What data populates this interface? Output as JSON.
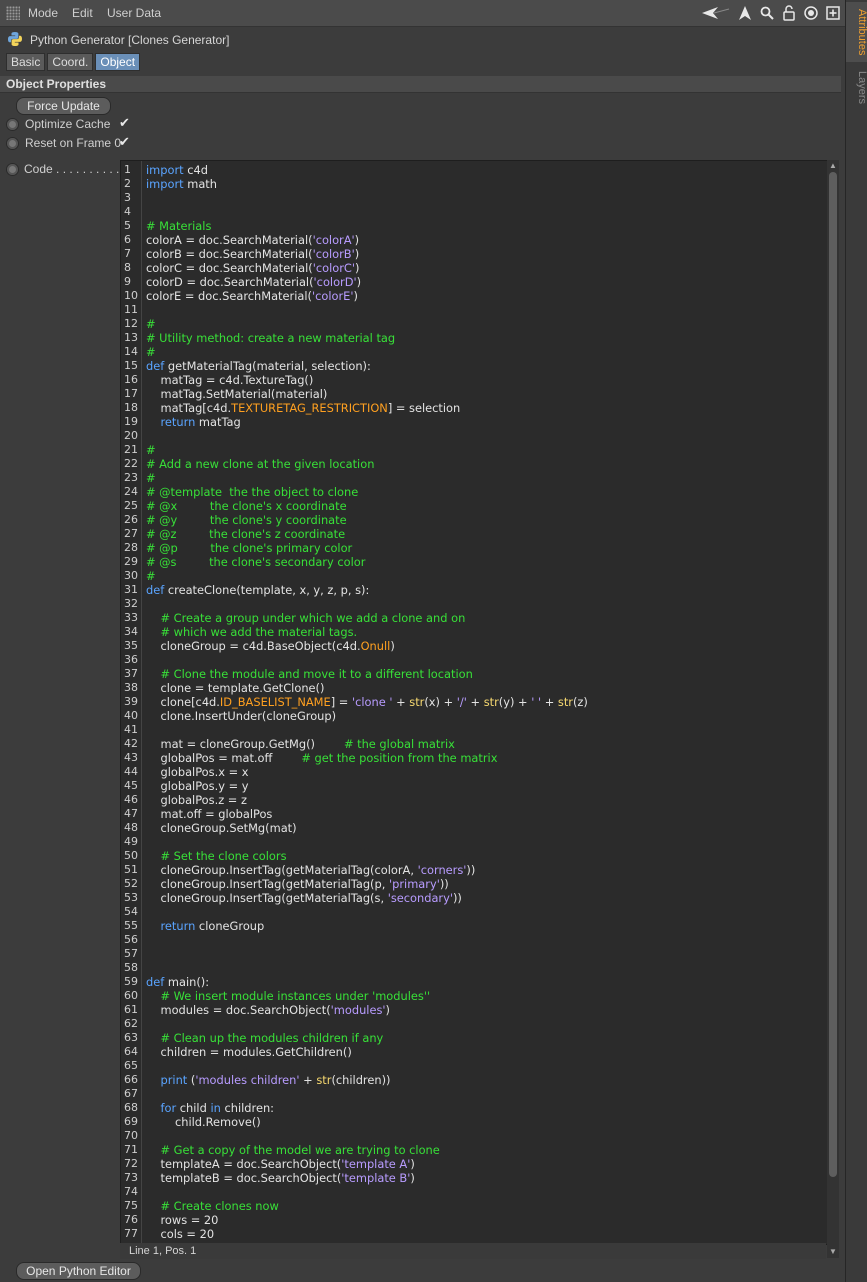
{
  "menubar": {
    "items": [
      "Mode",
      "Edit",
      "User Data"
    ],
    "icons": [
      "back-arrow-icon",
      "cursor-icon",
      "search-icon",
      "lock-icon",
      "target-icon",
      "new-window-icon"
    ]
  },
  "header": {
    "title": "Python Generator [Clones Generator]",
    "tabs": [
      {
        "label": "Basic",
        "active": false
      },
      {
        "label": "Coord.",
        "active": false
      },
      {
        "label": "Object",
        "active": true
      }
    ]
  },
  "section": {
    "title": "Object Properties"
  },
  "properties": {
    "force_update_label": "Force Update",
    "optimize_cache_label": "Optimize Cache",
    "optimize_cache_checked": true,
    "reset_on_frame_label": "Reset on Frame 0",
    "reset_on_frame_checked": true,
    "code_label": "Code . . . . . . . . . ."
  },
  "editor": {
    "language": "python",
    "lines": [
      [
        [
          "kw",
          "import"
        ],
        [
          "tx",
          " c4d"
        ]
      ],
      [
        [
          "kw",
          "import"
        ],
        [
          "tx",
          " math"
        ]
      ],
      [],
      [],
      [
        [
          "cm",
          "# Materials"
        ]
      ],
      [
        [
          "tx",
          "colorA = doc.SearchMaterial("
        ],
        [
          "st",
          "'colorA'"
        ],
        [
          "tx",
          ")"
        ]
      ],
      [
        [
          "tx",
          "colorB = doc.SearchMaterial("
        ],
        [
          "st",
          "'colorB'"
        ],
        [
          "tx",
          ")"
        ]
      ],
      [
        [
          "tx",
          "colorC = doc.SearchMaterial("
        ],
        [
          "st",
          "'colorC'"
        ],
        [
          "tx",
          ")"
        ]
      ],
      [
        [
          "tx",
          "colorD = doc.SearchMaterial("
        ],
        [
          "st",
          "'colorD'"
        ],
        [
          "tx",
          ")"
        ]
      ],
      [
        [
          "tx",
          "colorE = doc.SearchMaterial("
        ],
        [
          "st",
          "'colorE'"
        ],
        [
          "tx",
          ")"
        ]
      ],
      [],
      [
        [
          "cm",
          "#"
        ]
      ],
      [
        [
          "cm",
          "# Utility method: create a new material tag"
        ]
      ],
      [
        [
          "cm",
          "#"
        ]
      ],
      [
        [
          "kw",
          "def"
        ],
        [
          "tx",
          " getMaterialTag(material, selection):"
        ]
      ],
      [
        [
          "tx",
          "    matTag = c4d.TextureTag()"
        ]
      ],
      [
        [
          "tx",
          "    matTag.SetMaterial(material)"
        ]
      ],
      [
        [
          "tx",
          "    matTag[c4d."
        ],
        [
          "or",
          "TEXTURETAG_RESTRICTION"
        ],
        [
          "tx",
          "] = selection"
        ]
      ],
      [
        [
          "tx",
          "    "
        ],
        [
          "kw",
          "return"
        ],
        [
          "tx",
          " matTag"
        ]
      ],
      [],
      [
        [
          "cm",
          "#"
        ]
      ],
      [
        [
          "cm",
          "# Add a new clone at the given location"
        ]
      ],
      [
        [
          "cm",
          "#"
        ]
      ],
      [
        [
          "cm",
          "# @template  the the object to clone"
        ]
      ],
      [
        [
          "cm",
          "# @x         the clone's x coordinate"
        ]
      ],
      [
        [
          "cm",
          "# @y         the clone's y coordinate"
        ]
      ],
      [
        [
          "cm",
          "# @z         the clone's z coordinate"
        ]
      ],
      [
        [
          "cm",
          "# @p         the clone's primary color"
        ]
      ],
      [
        [
          "cm",
          "# @s         the clone's secondary color"
        ]
      ],
      [
        [
          "cm",
          "#"
        ]
      ],
      [
        [
          "kw",
          "def"
        ],
        [
          "tx",
          " createClone(template, x, y, z, p, s):"
        ]
      ],
      [],
      [
        [
          "tx",
          "    "
        ],
        [
          "cm",
          "# Create a group under which we add a clone and on"
        ]
      ],
      [
        [
          "tx",
          "    "
        ],
        [
          "cm",
          "# which we add the material tags."
        ]
      ],
      [
        [
          "tx",
          "    cloneGroup = c4d.BaseObject(c4d."
        ],
        [
          "or",
          "Onull"
        ],
        [
          "tx",
          ")"
        ]
      ],
      [],
      [
        [
          "tx",
          "    "
        ],
        [
          "cm",
          "# Clone the module and move it to a different location"
        ]
      ],
      [
        [
          "tx",
          "    clone = template.GetClone()"
        ]
      ],
      [
        [
          "tx",
          "    clone[c4d."
        ],
        [
          "or",
          "ID_BASELIST_NAME"
        ],
        [
          "tx",
          "] = "
        ],
        [
          "st",
          "'clone '"
        ],
        [
          "tx",
          " + "
        ],
        [
          "bi",
          "str"
        ],
        [
          "tx",
          "(x) + "
        ],
        [
          "st",
          "'/'"
        ],
        [
          "tx",
          " + "
        ],
        [
          "bi",
          "str"
        ],
        [
          "tx",
          "(y) + "
        ],
        [
          "st",
          "' '"
        ],
        [
          "tx",
          " + "
        ],
        [
          "bi",
          "str"
        ],
        [
          "tx",
          "(z)"
        ]
      ],
      [
        [
          "tx",
          "    clone.InsertUnder(cloneGroup)"
        ]
      ],
      [],
      [
        [
          "tx",
          "    mat = cloneGroup.GetMg()        "
        ],
        [
          "cm",
          "# the global matrix"
        ]
      ],
      [
        [
          "tx",
          "    globalPos = mat.off        "
        ],
        [
          "cm",
          "# get the position from the matrix"
        ]
      ],
      [
        [
          "tx",
          "    globalPos.x = x"
        ]
      ],
      [
        [
          "tx",
          "    globalPos.y = y"
        ]
      ],
      [
        [
          "tx",
          "    globalPos.z = z"
        ]
      ],
      [
        [
          "tx",
          "    mat.off = globalPos"
        ]
      ],
      [
        [
          "tx",
          "    cloneGroup.SetMg(mat)"
        ]
      ],
      [],
      [
        [
          "tx",
          "    "
        ],
        [
          "cm",
          "# Set the clone colors"
        ]
      ],
      [
        [
          "tx",
          "    cloneGroup.InsertTag(getMaterialTag(colorA, "
        ],
        [
          "st",
          "'corners'"
        ],
        [
          "tx",
          "))"
        ]
      ],
      [
        [
          "tx",
          "    cloneGroup.InsertTag(getMaterialTag(p, "
        ],
        [
          "st",
          "'primary'"
        ],
        [
          "tx",
          "))"
        ]
      ],
      [
        [
          "tx",
          "    cloneGroup.InsertTag(getMaterialTag(s, "
        ],
        [
          "st",
          "'secondary'"
        ],
        [
          "tx",
          "))"
        ]
      ],
      [],
      [
        [
          "tx",
          "    "
        ],
        [
          "kw",
          "return"
        ],
        [
          "tx",
          " cloneGroup"
        ]
      ],
      [],
      [],
      [],
      [
        [
          "kw",
          "def"
        ],
        [
          "tx",
          " main():"
        ]
      ],
      [
        [
          "tx",
          "    "
        ],
        [
          "cm",
          "# We insert module instances under 'modules''"
        ]
      ],
      [
        [
          "tx",
          "    modules = doc.SearchObject("
        ],
        [
          "st",
          "'modules'"
        ],
        [
          "tx",
          ")"
        ]
      ],
      [],
      [
        [
          "tx",
          "    "
        ],
        [
          "cm",
          "# Clean up the modules children if any"
        ]
      ],
      [
        [
          "tx",
          "    children = modules.GetChildren()"
        ]
      ],
      [],
      [
        [
          "tx",
          "    "
        ],
        [
          "kw",
          "print"
        ],
        [
          "tx",
          " ("
        ],
        [
          "st",
          "'modules children'"
        ],
        [
          "tx",
          " + "
        ],
        [
          "bi",
          "str"
        ],
        [
          "tx",
          "(children))"
        ]
      ],
      [],
      [
        [
          "tx",
          "    "
        ],
        [
          "kw",
          "for"
        ],
        [
          "tx",
          " child "
        ],
        [
          "kw",
          "in"
        ],
        [
          "tx",
          " children:"
        ]
      ],
      [
        [
          "tx",
          "        child.Remove()"
        ]
      ],
      [],
      [
        [
          "tx",
          "    "
        ],
        [
          "cm",
          "# Get a copy of the model we are trying to clone"
        ]
      ],
      [
        [
          "tx",
          "    templateA = doc.SearchObject("
        ],
        [
          "st",
          "'template A'"
        ],
        [
          "tx",
          ")"
        ]
      ],
      [
        [
          "tx",
          "    templateB = doc.SearchObject("
        ],
        [
          "st",
          "'template B'"
        ],
        [
          "tx",
          ")"
        ]
      ],
      [],
      [
        [
          "tx",
          "    "
        ],
        [
          "cm",
          "# Create clones now"
        ]
      ],
      [
        [
          "tx",
          "    rows = 20"
        ]
      ],
      [
        [
          "tx",
          "    cols = 20"
        ]
      ]
    ],
    "status": "Line 1, Pos. 1"
  },
  "footer": {
    "open_editor_label": "Open Python Editor"
  },
  "sidebar": {
    "tabs": [
      "Attributes",
      "Layers"
    ]
  }
}
